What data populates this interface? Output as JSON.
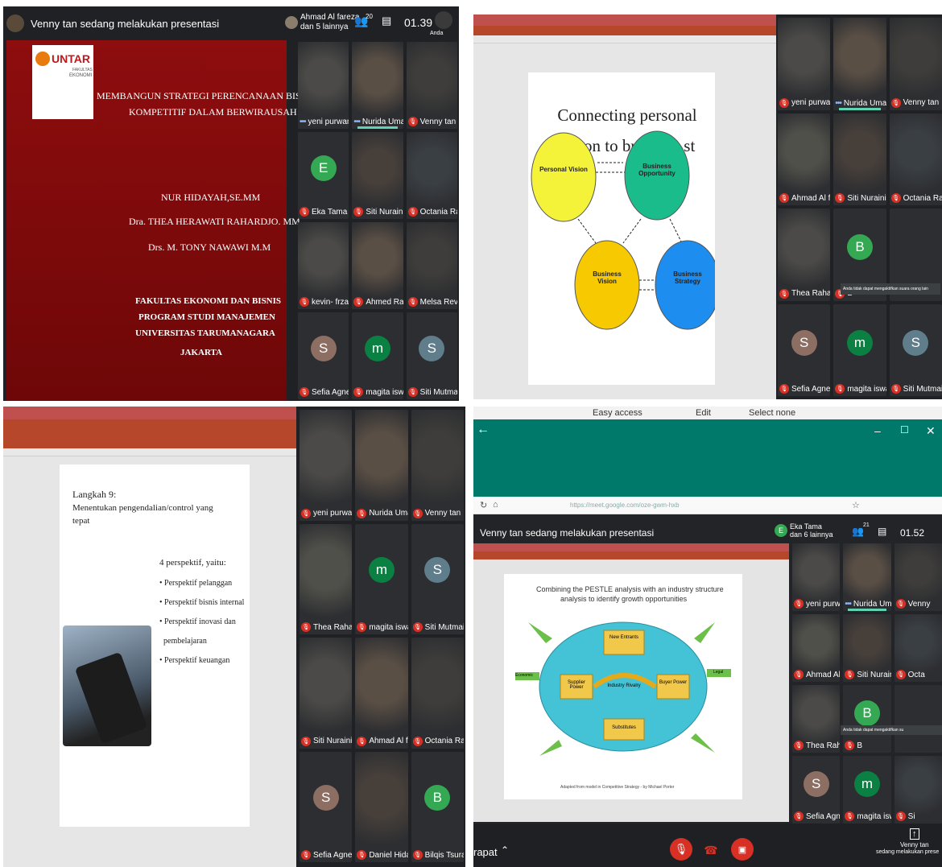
{
  "panel1": {
    "presenting_text": "Venny tan sedang melakukan presentasi",
    "participant_badge": {
      "name": "Ahmad Al fareza",
      "others": "dan 5 lainnya"
    },
    "people_count": "20",
    "time": "01.39",
    "self_label": "Anda",
    "slide": {
      "logo": "UNTAR",
      "faculty_small_1": "FAKULTAS",
      "faculty_small_2": "EKONOMI",
      "title_line1": "MEMBANGUN STRATEGI PERENCANAAN  BISI",
      "title_line2": "KOMPETITIF DALAM BERWIRAUSAH",
      "author1": "NUR HIDAYAH,SE.MM",
      "author2": "Dra. THEA HERAWATI RAHARDJO. MM",
      "author3": "Drs. M. TONY NAWAWI M.M",
      "org1": "FAKULTAS EKONOMI DAN BISNIS",
      "org2": "PROGRAM STUDI MANAJEMEN",
      "org3": "UNIVERSITAS TARUMANAGARA",
      "org4": "JAKARTA"
    },
    "tiles": [
      {
        "name": "yeni purwanti",
        "status": "dots"
      },
      {
        "name": "Nurida Umard...",
        "status": "speaking"
      },
      {
        "name": "Venny tan",
        "status": "muted"
      },
      {
        "name": "Eka Tama",
        "status": "muted",
        "initial": "E",
        "color": "#34a853"
      },
      {
        "name": "Siti Nuraini Ra...",
        "status": "muted"
      },
      {
        "name": "Octania Ram...",
        "status": "muted"
      },
      {
        "name": "kevin- frzadv",
        "status": "muted"
      },
      {
        "name": "Ahmed Rafi",
        "status": "muted"
      },
      {
        "name": "Melsa Revalina",
        "status": "muted"
      },
      {
        "name": "Sefia Agnes",
        "status": "muted",
        "initial": "S",
        "color": "#8d6e63"
      },
      {
        "name": "magita iswandi",
        "status": "muted",
        "initial": "m",
        "color": "#0b8043"
      },
      {
        "name": "Siti Mutmainah",
        "status": "muted",
        "initial": "S",
        "color": "#607d8b"
      }
    ]
  },
  "panel2": {
    "slide_title": "Connecting personal vision to business st",
    "circles": {
      "personal": "Personal Vision",
      "opportunity": "Business Opportunity",
      "vision": "Business Vision",
      "strategy": "Business Strategy"
    },
    "tooltip": "Anda tidak dapat mengaktifkan suara orang lain",
    "tiles": [
      {
        "name": "yeni purwanti",
        "status": "muted"
      },
      {
        "name": "Nurida Umard...",
        "status": "speaking"
      },
      {
        "name": "Venny tan",
        "status": "muted"
      },
      {
        "name": "Ahmad Al far...",
        "status": "muted"
      },
      {
        "name": "Siti Nuraini Ra...",
        "status": "muted"
      },
      {
        "name": "Octania Ram...",
        "status": "muted"
      },
      {
        "name": "Thea Rahardjo",
        "status": "muted"
      },
      {
        "name": "B",
        "status": "muted",
        "initial": "B",
        "color": "#34a853"
      },
      {
        "name": "",
        "status": "none"
      },
      {
        "name": "Sefia Agnes",
        "status": "muted",
        "initial": "S",
        "color": "#8d6e63"
      },
      {
        "name": "magita iswandi",
        "status": "muted",
        "initial": "m",
        "color": "#0b8043"
      },
      {
        "name": "Siti Mutmainah",
        "status": "muted",
        "initial": "S",
        "color": "#607d8b"
      }
    ]
  },
  "panel3": {
    "slide": {
      "heading1": "Langkah 9:",
      "heading2": "Menentukan pengendalian/control  yang",
      "heading3": "tepat",
      "list_title": "4 perspektif, yaitu:",
      "items": [
        "Perspektif pelanggan",
        "Perspektif bisnis internal",
        "Perspektif inovasi dan",
        "pembelajaran",
        "Perspektif keuangan"
      ]
    },
    "tiles": [
      {
        "name": "yeni purwanti",
        "status": "muted"
      },
      {
        "name": "Nurida Umard...",
        "status": "muted"
      },
      {
        "name": "Venny tan",
        "status": "muted"
      },
      {
        "name": "Thea Rahardjo",
        "status": "muted"
      },
      {
        "name": "magita iswandi",
        "status": "muted",
        "initial": "m",
        "color": "#0b8043"
      },
      {
        "name": "Siti Mutmainah",
        "status": "muted",
        "initial": "S",
        "color": "#607d8b"
      },
      {
        "name": "Siti Nuraini R...",
        "status": "muted"
      },
      {
        "name": "Ahmad Al far...",
        "status": "muted"
      },
      {
        "name": "Octania Ram...",
        "status": "muted"
      },
      {
        "name": "Sefia Agnes",
        "status": "muted",
        "initial": "S",
        "color": "#8d6e63"
      },
      {
        "name": "Daniel Hidayat",
        "status": "muted"
      },
      {
        "name": "Bilqis Tsurayya",
        "status": "muted",
        "initial": "B",
        "color": "#34a853"
      }
    ]
  },
  "panel4": {
    "top_menu": {
      "easy_access": "Easy access",
      "edit": "Edit",
      "select_none": "Select none"
    },
    "url": "https://meet.google.com/oze-gwm-hxb",
    "presenting_text": "Venny tan sedang melakukan presentasi",
    "participant_badge": {
      "initial": "E",
      "name": "Eka Tama",
      "others": "dan 6 lainnya"
    },
    "people_count": "21",
    "time": "01.52",
    "slide": {
      "title_line1": "Combining the PESTLE analysis with an industry structure",
      "title_line2": "analysis to identify growth opportunities",
      "new_entrants": "New Entrants",
      "supplier_power": "Supplier Power",
      "industry_rivalry": "Industry Rivalry",
      "buyer_power": "Buyer Power",
      "substitutes": "Substitutes",
      "economic": "Economic",
      "legal": "Legal",
      "footer": "Adapted from model in Competitive Strategy - by Michael Porter"
    },
    "meeting_label": "rapat",
    "bottom_right": "Venny tan",
    "bottom_right2": "sedang melakukan prese",
    "tooltip": "Anda tidak dapat mengaktifkan su",
    "tiles": [
      {
        "name": "yeni purwanti",
        "status": "muted"
      },
      {
        "name": "Nurida Umard...",
        "status": "speaking"
      },
      {
        "name": "Venny",
        "status": "muted"
      },
      {
        "name": "Ahmad Al far...",
        "status": "muted"
      },
      {
        "name": "Siti Nuraini Ra...",
        "status": "muted"
      },
      {
        "name": "Octa",
        "status": "muted"
      },
      {
        "name": "Thea Rahardjo",
        "status": "muted"
      },
      {
        "name": "B",
        "status": "muted",
        "initial": "B",
        "color": "#34a853"
      },
      {
        "name": "",
        "status": "none"
      },
      {
        "name": "Sefia Agnes",
        "status": "muted",
        "initial": "S",
        "color": "#8d6e63"
      },
      {
        "name": "magita iswandi",
        "status": "muted",
        "initial": "m",
        "color": "#0b8043"
      },
      {
        "name": "Si",
        "status": "muted"
      }
    ]
  },
  "colors": {
    "meet_bg": "#202124",
    "mute_red": "#d93025",
    "untar_red": "#b0181a",
    "teal": "#00796b"
  }
}
